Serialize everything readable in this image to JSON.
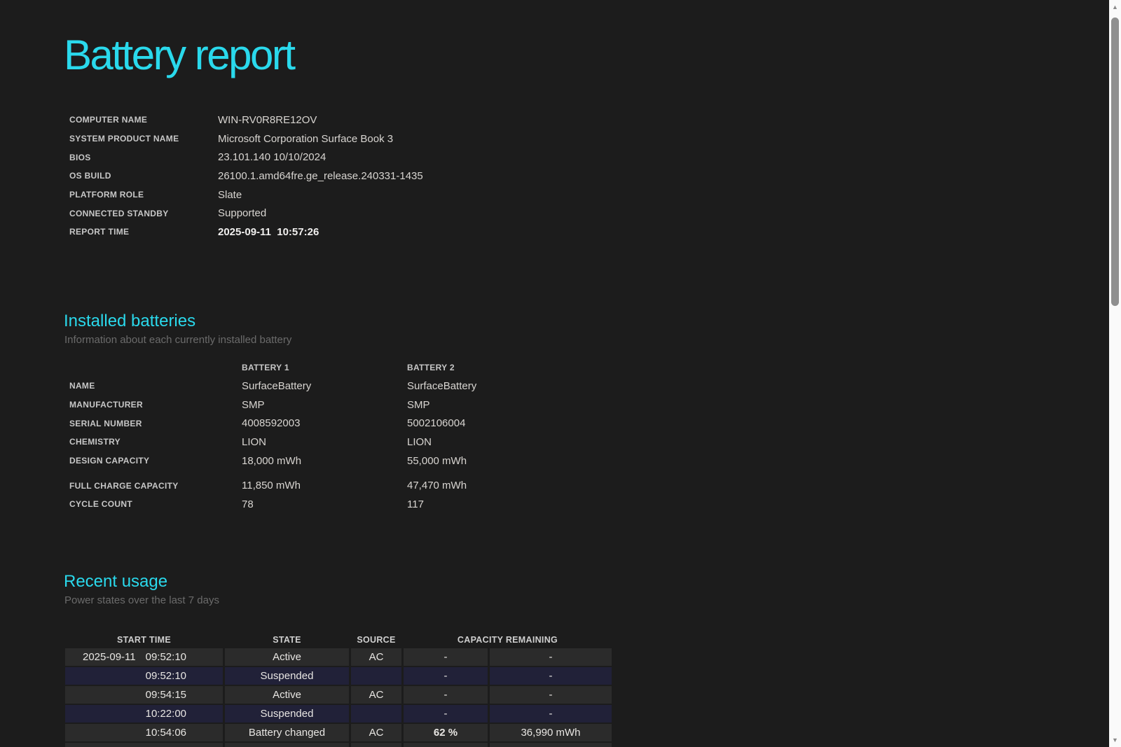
{
  "colors": {
    "accent": "#2ad9ec",
    "page_bg": "#1c1c1c",
    "row_active_bg": "#2b2b2b",
    "row_suspended_bg": "#212138"
  },
  "title": "Battery report",
  "system_info": [
    {
      "label": "COMPUTER NAME",
      "value": "WIN-RV0R8RE12OV"
    },
    {
      "label": "SYSTEM PRODUCT NAME",
      "value": "Microsoft Corporation Surface Book 3"
    },
    {
      "label": "BIOS",
      "value": "23.101.140 10/10/2024"
    },
    {
      "label": "OS BUILD",
      "value": "26100.1.amd64fre.ge_release.240331-1435"
    },
    {
      "label": "PLATFORM ROLE",
      "value": "Slate"
    },
    {
      "label": "CONNECTED STANDBY",
      "value": "Supported"
    },
    {
      "label": "REPORT TIME",
      "value": "2025-09-11  10:57:26",
      "bold": true
    }
  ],
  "installed_batteries": {
    "heading": "Installed batteries",
    "subtitle": "Information about each currently installed battery",
    "columns": [
      "BATTERY 1",
      "BATTERY 2"
    ],
    "rows": [
      {
        "label": "NAME",
        "values": [
          "SurfaceBattery",
          "SurfaceBattery"
        ]
      },
      {
        "label": "MANUFACTURER",
        "values": [
          "SMP",
          "SMP"
        ]
      },
      {
        "label": "SERIAL NUMBER",
        "values": [
          "4008592003",
          "5002106004"
        ]
      },
      {
        "label": "CHEMISTRY",
        "values": [
          "LION",
          "LION"
        ]
      },
      {
        "label": "DESIGN CAPACITY",
        "values": [
          "18,000 mWh",
          "55,000 mWh"
        ]
      },
      {
        "label": "FULL CHARGE CAPACITY",
        "values": [
          "11,850 mWh",
          "47,470 mWh"
        ],
        "gap_before": true
      },
      {
        "label": "CYCLE COUNT",
        "values": [
          "78",
          "117"
        ]
      }
    ]
  },
  "recent_usage": {
    "heading": "Recent usage",
    "subtitle": "Power states over the last 7 days",
    "headers": [
      "START TIME",
      "STATE",
      "SOURCE",
      "CAPACITY REMAINING"
    ],
    "rows": [
      {
        "date": "2025-09-11",
        "time": "09:52:10",
        "state": "Active",
        "source": "AC",
        "percent": "-",
        "mwh": "-",
        "variant": "active"
      },
      {
        "date": "",
        "time": "09:52:10",
        "state": "Suspended",
        "source": "",
        "percent": "-",
        "mwh": "-",
        "variant": "suspended"
      },
      {
        "date": "",
        "time": "09:54:15",
        "state": "Active",
        "source": "AC",
        "percent": "-",
        "mwh": "-",
        "variant": "active"
      },
      {
        "date": "",
        "time": "10:22:00",
        "state": "Suspended",
        "source": "",
        "percent": "-",
        "mwh": "-",
        "variant": "suspended"
      },
      {
        "date": "",
        "time": "10:54:06",
        "state": "Battery changed",
        "source": "AC",
        "percent": "62 %",
        "mwh": "36,990 mWh",
        "variant": "active",
        "percent_bold": true
      },
      {
        "date": "",
        "time": "",
        "state": "",
        "source": "",
        "percent": "",
        "mwh": "",
        "variant": "active",
        "partial": true
      }
    ]
  },
  "scrollbar": {
    "up_icon": "▲",
    "down_icon": "▼"
  }
}
